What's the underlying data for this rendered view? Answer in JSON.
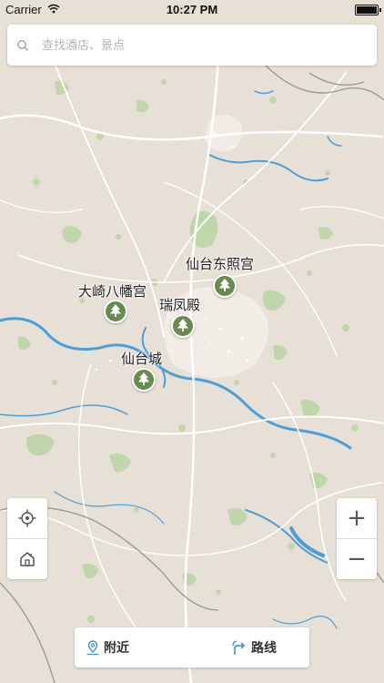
{
  "status_bar": {
    "carrier": "Carrier",
    "time": "10:27 PM"
  },
  "search": {
    "placeholder": "查找酒店、景点"
  },
  "map": {
    "pois": [
      {
        "name": "仙台东照宫",
        "icon": "tree-icon"
      },
      {
        "name": "大崎八幡宫",
        "icon": "tree-icon"
      },
      {
        "name": "瑞凤殿",
        "icon": "tree-icon"
      },
      {
        "name": "仙台城",
        "icon": "tree-icon"
      }
    ],
    "colors": {
      "land": "#e7e0d6",
      "water": "#4a9fd8",
      "green": "#b6d3a0",
      "road": "#ffffff",
      "poi_marker": "#6b8a4f"
    }
  },
  "controls": {
    "locate_icon": "crosshair-icon",
    "home_icon": "home-icon",
    "zoom_in": "+",
    "zoom_out": "−"
  },
  "bottom_bar": {
    "nearby_label": "附近",
    "route_label": "路线"
  }
}
